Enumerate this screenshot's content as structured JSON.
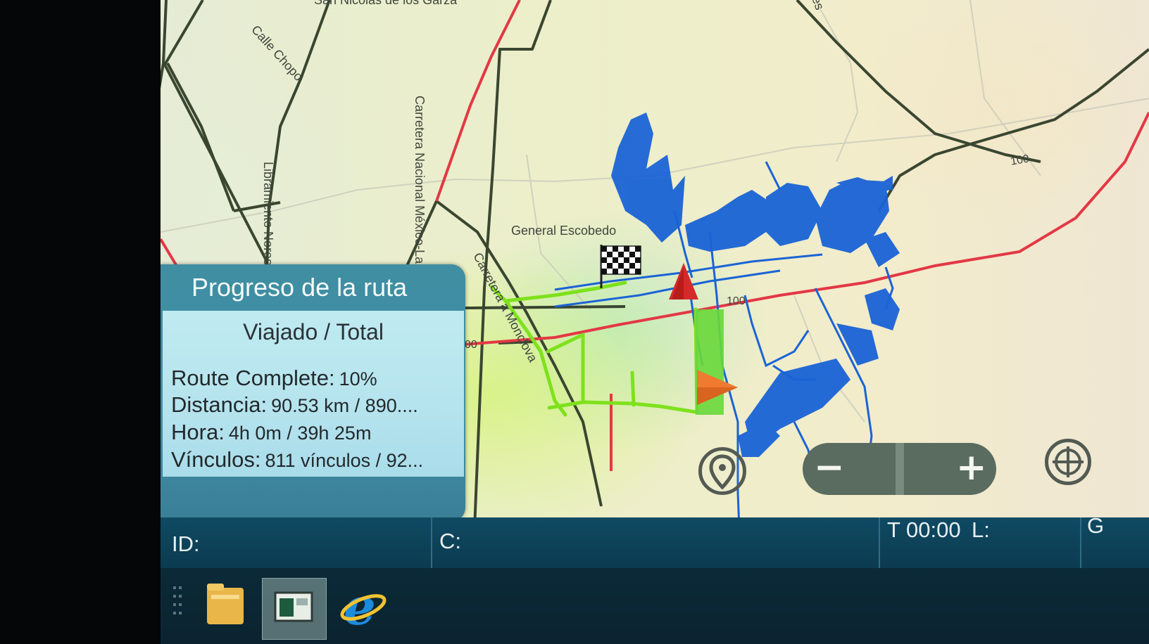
{
  "map": {
    "labels": [
      "San Nicolás de los Garza",
      "Calle Chopo",
      "Libramiento Noreste",
      "Carretera Nacional México-Laredo",
      "General Escobedo",
      "Carretera a Monclova",
      "es"
    ],
    "road_numbers": [
      "100",
      "100",
      "00"
    ],
    "colors": {
      "main_road": "#e33845",
      "secondary_road": "#3a4630",
      "urban_area": "#1a63d6",
      "route": "#7ee11d"
    },
    "markers": {
      "destination": "checkered-flag-icon",
      "current_position": "red-triangle-icon",
      "vehicle": "orange-arrow-icon"
    },
    "controls": {
      "location": "location-pin-icon",
      "zoom_out": "−",
      "zoom_in": "+",
      "center": "crosshair-icon"
    }
  },
  "panel": {
    "title": "Progreso de la ruta",
    "subtitle": "Viajado / Total",
    "route_complete_label": "Route Complete:",
    "route_complete_value": "10%",
    "distance_label": "Distancia:",
    "distance_value": "90.53 km / 890....",
    "time_label": "Hora:",
    "time_value": "4h 0m / 39h 25m",
    "links_label": "Vínculos:",
    "links_value": "811 vínculos / 92..."
  },
  "statusbar": {
    "id_label": "ID:",
    "c_label": "C:",
    "time": "T 00:00",
    "l_label": "L:",
    "g_label": "G"
  },
  "taskbar": {
    "apps": [
      "file-explorer-icon",
      "app-window-icon",
      "internet-explorer-icon"
    ]
  }
}
